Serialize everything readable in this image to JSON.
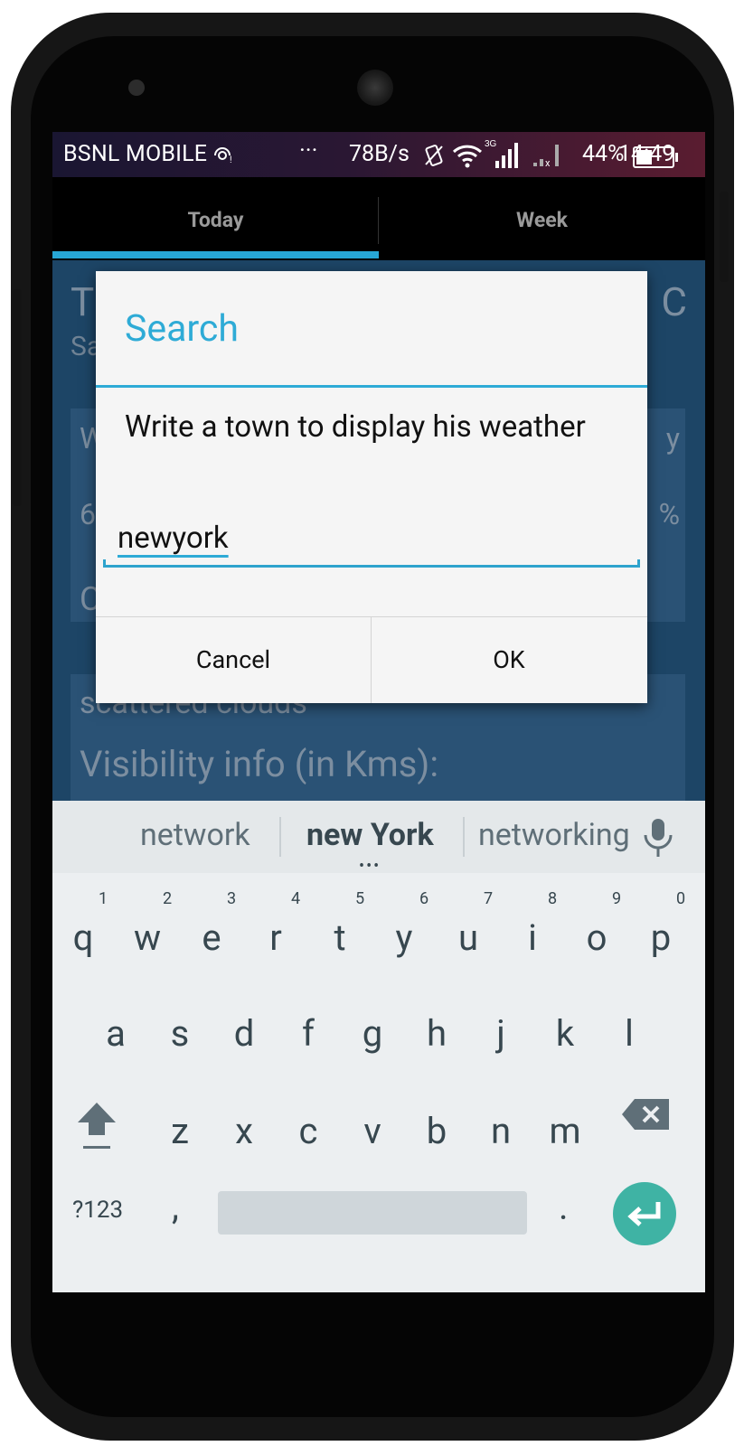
{
  "status_bar": {
    "carrier": "BSNL MOBILE",
    "extra": "···",
    "speed": "78B/s",
    "network": "3G",
    "battery_percent": "44%",
    "battery_level": 0.44,
    "time": "14:49"
  },
  "tabs": [
    {
      "label": "Today",
      "selected": true
    },
    {
      "label": "Week",
      "selected": false
    }
  ],
  "background": {
    "title_left": "T",
    "title_right": "C",
    "subtitle": "Sa",
    "card_w": "W",
    "card_y": "y",
    "card_6": "6",
    "card_pct": "%",
    "card_c": "C",
    "scattered": "scattered clouds",
    "visibility": "Visibility info (in Kms):"
  },
  "dialog": {
    "title": "Search",
    "message": "Write a town to display his weather",
    "input_value": "newyork",
    "cancel_label": "Cancel",
    "ok_label": "OK"
  },
  "keyboard": {
    "suggestions": [
      "network",
      "new York",
      "networking"
    ],
    "row1": [
      "q",
      "w",
      "e",
      "r",
      "t",
      "y",
      "u",
      "i",
      "o",
      "p"
    ],
    "row1_hints": [
      "1",
      "2",
      "3",
      "4",
      "5",
      "6",
      "7",
      "8",
      "9",
      "0"
    ],
    "row2": [
      "a",
      "s",
      "d",
      "f",
      "g",
      "h",
      "j",
      "k",
      "l"
    ],
    "row3": [
      "z",
      "x",
      "c",
      "v",
      "b",
      "n",
      "m"
    ],
    "symbols_label": "?123",
    "comma": ",",
    "period": "."
  },
  "colors": {
    "accent": "#2eabd6",
    "enter_key": "#3fb3a4"
  }
}
